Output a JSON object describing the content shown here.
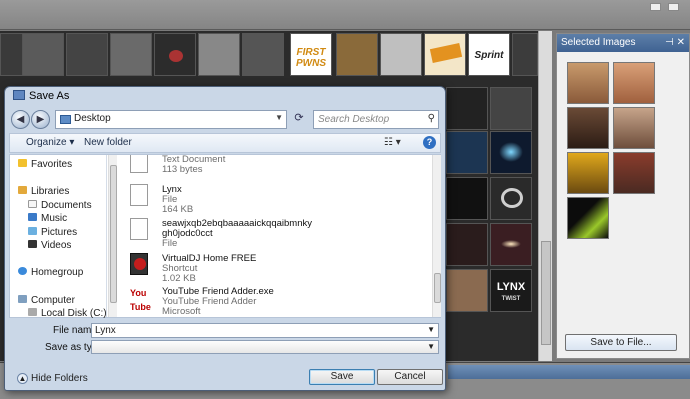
{
  "dialog": {
    "title": "Save As",
    "address": "Desktop",
    "search_placeholder": "Search Desktop",
    "toolbar": {
      "organize": "Organize",
      "new_folder": "New folder"
    },
    "nav": {
      "favorites": "Favorites",
      "libraries": "Libraries",
      "documents": "Documents",
      "music": "Music",
      "pictures": "Pictures",
      "videos": "Videos",
      "homegroup": "Homegroup",
      "computer": "Computer",
      "local_disk": "Local Disk (C:)"
    },
    "files": [
      {
        "name": "Text Document",
        "detail": "113 bytes",
        "extra": ""
      },
      {
        "name": "Lynx",
        "detail": "File",
        "extra": "164 KB"
      },
      {
        "name": "seawjxqb2ebqbaaaaaickqqaibmnky",
        "detail": "gh0jodc0cct",
        "extra": "File"
      },
      {
        "name": "VirtualDJ Home FREE",
        "detail": "Shortcut",
        "extra": "1.02 KB"
      },
      {
        "name": "YouTube Friend Adder.exe",
        "detail": "YouTube Friend Adder",
        "extra": "Microsoft"
      }
    ],
    "file_name_label": "File name:",
    "file_name_value": "Lynx",
    "save_type_label": "Save as type:",
    "save_type_value": "",
    "hide_folders": "Hide Folders",
    "save": "Save",
    "cancel": "Cancel"
  },
  "panel": {
    "title": "Selected Images",
    "save_to_file": "Save to File..."
  },
  "thumbs": {
    "first_pwns_1": "FIRST",
    "first_pwns_2": "PWNS",
    "sprint": "Sprint",
    "lynx_1": "LYNX",
    "lynx_2": "TWIST",
    "youtube": "You Tube"
  },
  "colors": {
    "dialog_bg": "#cad7e7",
    "panel_header": "#4a6d9a",
    "accent": "#2f6fc2"
  }
}
